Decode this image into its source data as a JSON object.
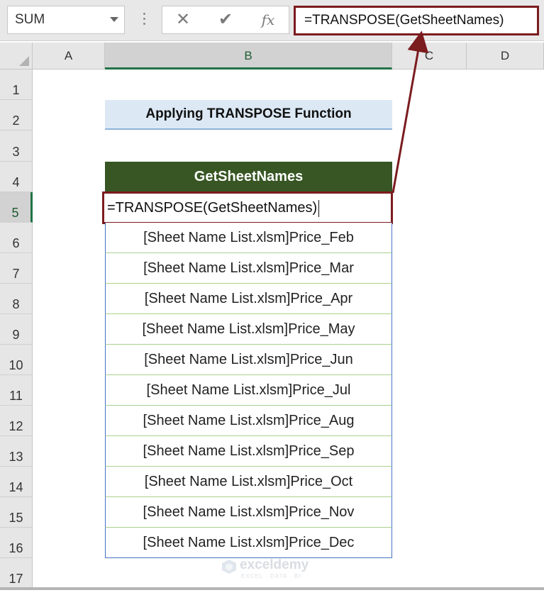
{
  "formula_bar": {
    "name_box": "SUM",
    "cancel_icon": "✕",
    "enter_icon": "✔",
    "fx_label": "fx",
    "formula": "=TRANSPOSE(GetSheetNames)"
  },
  "columns": [
    "A",
    "B",
    "C",
    "D"
  ],
  "rows": [
    "1",
    "2",
    "3",
    "4",
    "5",
    "6",
    "7",
    "8",
    "9",
    "10",
    "11",
    "12",
    "13",
    "14",
    "15",
    "16",
    "17"
  ],
  "active_cell": "B5",
  "sheet": {
    "title": "Applying TRANSPOSE Function",
    "table_header": "GetSheetNames",
    "edit_value": "=TRANSPOSE(GetSheetNames)",
    "values": [
      "[Sheet Name List.xlsm]Price_Feb",
      "[Sheet Name List.xlsm]Price_Mar",
      "[Sheet Name List.xlsm]Price_Apr",
      "[Sheet Name List.xlsm]Price_May",
      "[Sheet Name List.xlsm]Price_Jun",
      "[Sheet Name List.xlsm]Price_Jul",
      "[Sheet Name List.xlsm]Price_Aug",
      "[Sheet Name List.xlsm]Price_Sep",
      "[Sheet Name List.xlsm]Price_Oct",
      "[Sheet Name List.xlsm]Price_Nov",
      "[Sheet Name List.xlsm]Price_Dec"
    ]
  },
  "watermark": {
    "name": "exceldemy",
    "tagline": "EXCEL · DATA · BI"
  },
  "colors": {
    "highlight_border": "#7b1c1f",
    "header_fill": "#375623",
    "title_fill": "#dce9f5",
    "active_accent": "#217346"
  }
}
